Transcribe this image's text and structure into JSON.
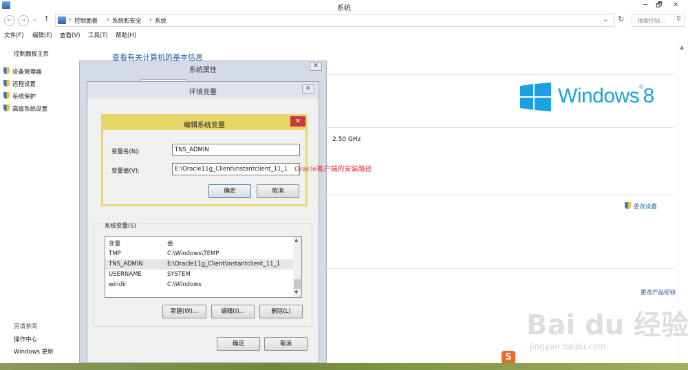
{
  "window": {
    "title": "系统",
    "minimize": "─",
    "restore": "🗗",
    "close": "✕"
  },
  "address": {
    "crumbs": [
      "控制面板",
      "系统和安全",
      "系统"
    ],
    "search_placeholder": "搜索控制..."
  },
  "menu": [
    "文件(F)",
    "编辑(E)",
    "查看(V)",
    "工具(T)",
    "帮助(H)"
  ],
  "left_pane": {
    "home": "控制面板主页",
    "links": [
      "设备管理器",
      "远程设置",
      "系统保护",
      "高级系统设置"
    ],
    "see_also": "另请参阅",
    "bottom_links": [
      "操作中心",
      "Windows 更新"
    ]
  },
  "content": {
    "heading": "查看有关计算机的基本信息",
    "logo_text": "Windows",
    "logo_num": "8",
    "cpu_freq": "2.50 GHz",
    "change_settings": "更改设置",
    "change_key": "更改产品密钥"
  },
  "sysprops_dialog": {
    "title": "系统属性"
  },
  "envvars_dialog": {
    "title": "环境变量",
    "system_vars_label": "系统变量(S)",
    "columns": [
      "变量",
      "值"
    ],
    "rows": [
      {
        "name": "TMP",
        "value": "C:\\Windows\\TEMP"
      },
      {
        "name": "TNS_ADMIN",
        "value": "E:\\Oracle11g_Client\\instantclient_11_1"
      },
      {
        "name": "USERNAME",
        "value": "SYSTEM"
      },
      {
        "name": "windir",
        "value": "C:\\Windows"
      }
    ],
    "new_btn": "新建(W)...",
    "edit_btn": "编辑(I)...",
    "delete_btn": "删除(L)",
    "ok_btn": "确定",
    "cancel_btn": "取消"
  },
  "edit_dialog": {
    "title": "编辑系统变量",
    "name_label": "变量名(N):",
    "name_value": "TNS_ADMIN",
    "value_label": "变量值(V):",
    "value_value": "E:\\Oracle11g_Client\\instantclient_11_1",
    "ok_btn": "确定",
    "cancel_btn": "取消"
  },
  "annotation": "Oracle客户端的安装路径",
  "watermark": {
    "text": "Bai du 经验",
    "url": "jingyan.baidu.com"
  },
  "colors": {
    "link": "#1e5aa8",
    "windows_logo": "#1ba1e2",
    "annotation": "#e0302a",
    "edit_dialog_border": "#e8d66b"
  }
}
